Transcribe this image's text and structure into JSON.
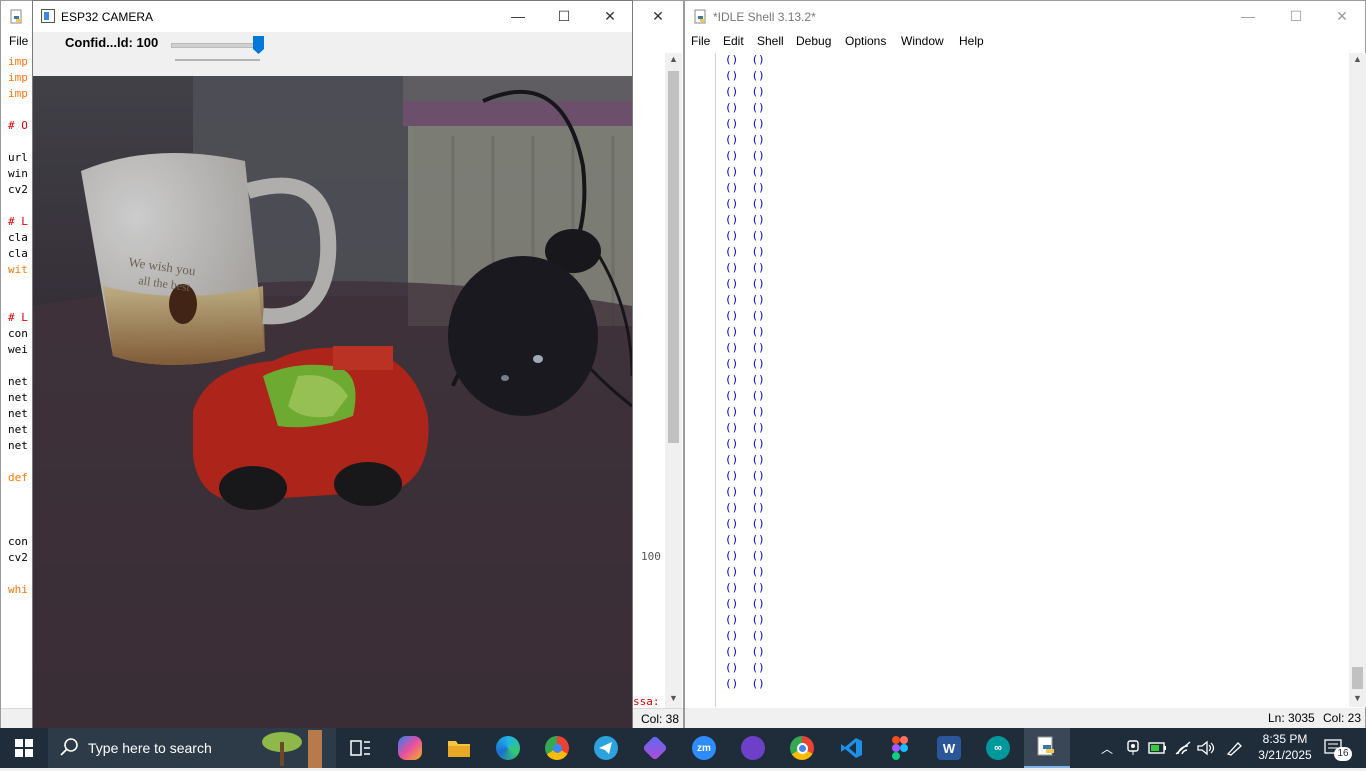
{
  "editor": {
    "menu_first": "File",
    "code_lines": [
      {
        "text": "imp",
        "cls": "kw"
      },
      {
        "text": "imp",
        "cls": "kw"
      },
      {
        "text": "imp",
        "cls": "kw"
      },
      {
        "text": "",
        "cls": ""
      },
      {
        "text": "# O",
        "cls": "cm"
      },
      {
        "text": "",
        "cls": ""
      },
      {
        "text": "url",
        "cls": ""
      },
      {
        "text": "win",
        "cls": ""
      },
      {
        "text": "cv2",
        "cls": ""
      },
      {
        "text": "",
        "cls": ""
      },
      {
        "text": "# L",
        "cls": "cm"
      },
      {
        "text": "cla",
        "cls": ""
      },
      {
        "text": "cla",
        "cls": ""
      },
      {
        "text": "wit",
        "cls": "kw"
      },
      {
        "text": "",
        "cls": ""
      },
      {
        "text": "",
        "cls": ""
      },
      {
        "text": "# L",
        "cls": "cm"
      },
      {
        "text": "con",
        "cls": ""
      },
      {
        "text": "wei",
        "cls": ""
      },
      {
        "text": "",
        "cls": ""
      },
      {
        "text": "net",
        "cls": ""
      },
      {
        "text": "net",
        "cls": ""
      },
      {
        "text": "net",
        "cls": ""
      },
      {
        "text": "net",
        "cls": ""
      },
      {
        "text": "net",
        "cls": ""
      },
      {
        "text": "",
        "cls": ""
      },
      {
        "text": "def",
        "cls": "kw"
      },
      {
        "text": "",
        "cls": ""
      },
      {
        "text": "",
        "cls": ""
      },
      {
        "text": "",
        "cls": ""
      },
      {
        "text": "con",
        "cls": ""
      },
      {
        "text": "cv2",
        "cls": ""
      },
      {
        "text": "",
        "cls": ""
      },
      {
        "text": "whi",
        "cls": "kw"
      }
    ],
    "right_fragment": "100",
    "bottom_fragment": "ssa:",
    "status_col": "Col: 38"
  },
  "camera": {
    "title": "ESP32 CAMERA",
    "trackbar_label": "Confid...ld: 100",
    "trackbar_value": 100,
    "trackbar_max": 100
  },
  "shell": {
    "title": "*IDLE Shell 3.13.2*",
    "menu": [
      "File",
      "Edit",
      "Shell",
      "Debug",
      "Options",
      "Window",
      "Help"
    ],
    "output_line": "()  ()",
    "output_line_count": 40,
    "status_ln": "Ln: 3035",
    "status_col": "Col: 23"
  },
  "taskbar": {
    "search_placeholder": "Type here to search",
    "apps": [
      "task-view",
      "copilot",
      "file-explorer",
      "edge",
      "chrome-profile",
      "telegram",
      "ms-designer",
      "zoom",
      "github-desktop",
      "chrome",
      "vscode",
      "figma",
      "word",
      "arduino",
      "python-idle"
    ],
    "time": "8:35 PM",
    "date": "3/21/2025",
    "notification_count": "16"
  },
  "colors": {
    "taskbar_bg": "#1f2c3a",
    "slider_thumb": "#0078d7",
    "shell_output": "#0000cc",
    "keyword": "#ff7700",
    "comment": "#dd0000"
  }
}
